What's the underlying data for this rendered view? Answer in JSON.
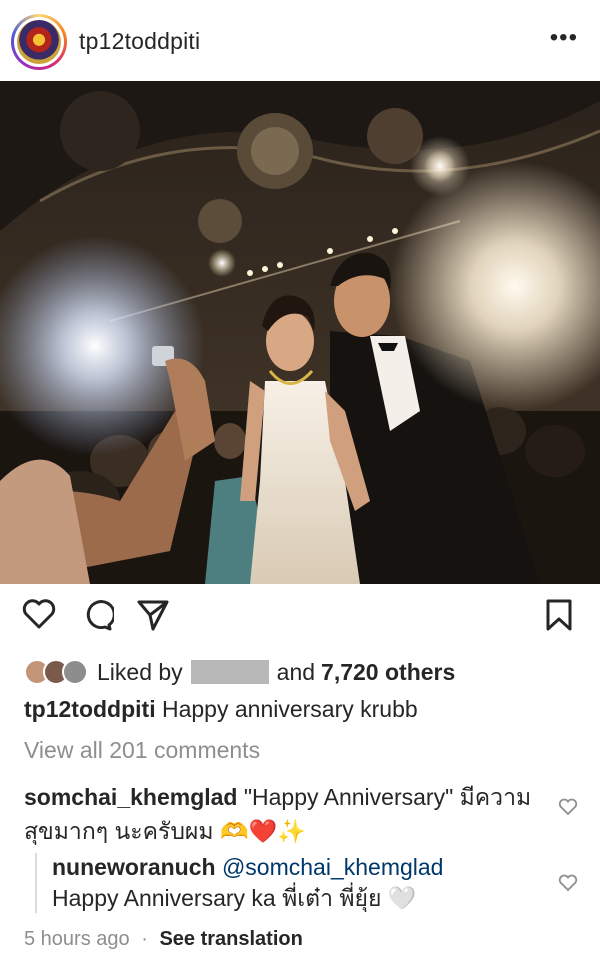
{
  "header": {
    "username": "tp12toddpiti",
    "more_label": "•••"
  },
  "photo": {
    "description_icon": "wedding-photo"
  },
  "actions": {
    "like_icon": "heart-icon",
    "comment_icon": "comment-icon",
    "share_icon": "send-icon",
    "save_icon": "bookmark-icon"
  },
  "likes": {
    "prefix": "Liked by",
    "middle": "and",
    "count_text": "7,720 others"
  },
  "caption": {
    "username": "tp12toddpiti",
    "text": "Happy anniversary krubb"
  },
  "view_all": "View all 201 comments",
  "comments": [
    {
      "username": "somchai_khemglad",
      "text": "\"Happy Anniversary\" มีความสุขมากๆ นะครับผม 🫶❤️✨"
    }
  ],
  "replies": [
    {
      "username": "nuneworanuch",
      "mention": "@somchai_khemglad",
      "text": "Happy Anniversary ka พี่เต๋า พี่ยุ้ย 🤍"
    }
  ],
  "footer": {
    "time": "5 hours ago",
    "separator": "·",
    "translate": "See translation"
  },
  "colors": {
    "text": "#262626",
    "muted": "#8e8e8e",
    "link": "#00376b"
  }
}
